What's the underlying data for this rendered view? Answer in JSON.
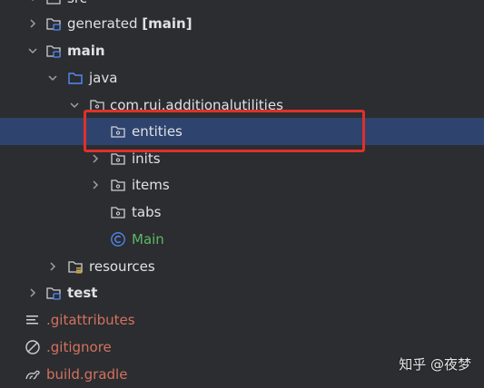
{
  "tree": {
    "items": [
      {
        "label": "src",
        "name_suffix": "",
        "state": "expanded"
      },
      {
        "label": "generated",
        "name_suffix": "[main]",
        "state": "collapsed"
      },
      {
        "label": "main",
        "name_suffix": "",
        "state": "expanded"
      },
      {
        "label": "java",
        "name_suffix": "",
        "state": "expanded"
      },
      {
        "label": "com.rui.additionalutilities",
        "name_suffix": "",
        "state": "expanded"
      },
      {
        "label": "entities",
        "name_suffix": "",
        "state": "leaf",
        "selected": true
      },
      {
        "label": "inits",
        "name_suffix": "",
        "state": "collapsed"
      },
      {
        "label": "items",
        "name_suffix": "",
        "state": "collapsed"
      },
      {
        "label": "tabs",
        "name_suffix": "",
        "state": "leaf"
      },
      {
        "label": "Main",
        "name_suffix": "",
        "state": "leaf"
      },
      {
        "label": "resources",
        "name_suffix": "",
        "state": "collapsed"
      },
      {
        "label": "test",
        "name_suffix": "",
        "state": "collapsed"
      },
      {
        "label": ".gitattributes",
        "name_suffix": "",
        "state": "leaf"
      },
      {
        "label": ".gitignore",
        "name_suffix": "",
        "state": "leaf"
      },
      {
        "label": "build.gradle",
        "name_suffix": "",
        "state": "leaf"
      }
    ]
  },
  "watermark": "知乎 @夜梦",
  "colors": {
    "background": "#2b2d30",
    "selection": "#2e436e",
    "highlight_border": "#e0302a",
    "class_green": "#5fb865",
    "ignored_file": "#d4715f",
    "folder_blue": "#548af7"
  }
}
